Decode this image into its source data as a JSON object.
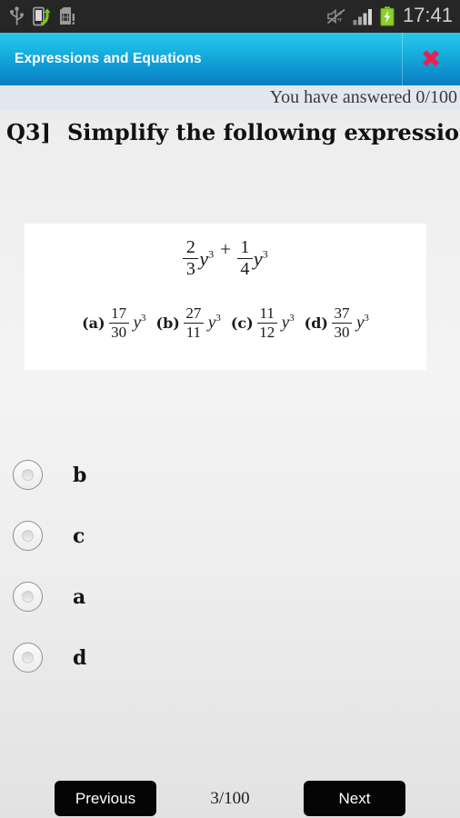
{
  "statusbar": {
    "icons_left": [
      "usb-icon",
      "phone-transfer-icon",
      "sim-card-alert-icon"
    ],
    "icons_right": [
      "mute-vibrate-off-icon",
      "signal-bars-icon",
      "battery-charging-icon"
    ],
    "clock": "17:41",
    "battery_color": "#7cc41f"
  },
  "titlebar": {
    "title": "Expressions and Equations",
    "close_label": "✖",
    "gradient_top": "#2ac8ea",
    "gradient_bottom": "#0a7cc2",
    "close_color": "#ec1f53"
  },
  "progress": {
    "answered_text": "You have answered 0/100"
  },
  "question": {
    "number": "Q3]",
    "text": "Simplify the following expressions"
  },
  "math_card": {
    "expression": {
      "term1": {
        "numerator": "2",
        "denominator": "3",
        "variable": "y",
        "exponent": "3"
      },
      "operator": "+",
      "term2": {
        "numerator": "1",
        "denominator": "4",
        "variable": "y",
        "exponent": "3"
      }
    },
    "options": [
      {
        "label": "(a)",
        "numerator": "17",
        "denominator": "30",
        "variable": "y",
        "exponent": "3"
      },
      {
        "label": "(b)",
        "numerator": "27",
        "denominator": "11",
        "variable": "y",
        "exponent": "3"
      },
      {
        "label": "(c)",
        "numerator": "11",
        "denominator": "12",
        "variable": "y",
        "exponent": "3"
      },
      {
        "label": "(d)",
        "numerator": "37",
        "denominator": "30",
        "variable": "y",
        "exponent": "3"
      }
    ]
  },
  "choices": [
    {
      "label": "b",
      "selected": false
    },
    {
      "label": "c",
      "selected": false
    },
    {
      "label": "a",
      "selected": false
    },
    {
      "label": "d",
      "selected": false
    }
  ],
  "bottom_nav": {
    "previous_label": "Previous",
    "page_counter": "3/100",
    "next_label": "Next"
  }
}
